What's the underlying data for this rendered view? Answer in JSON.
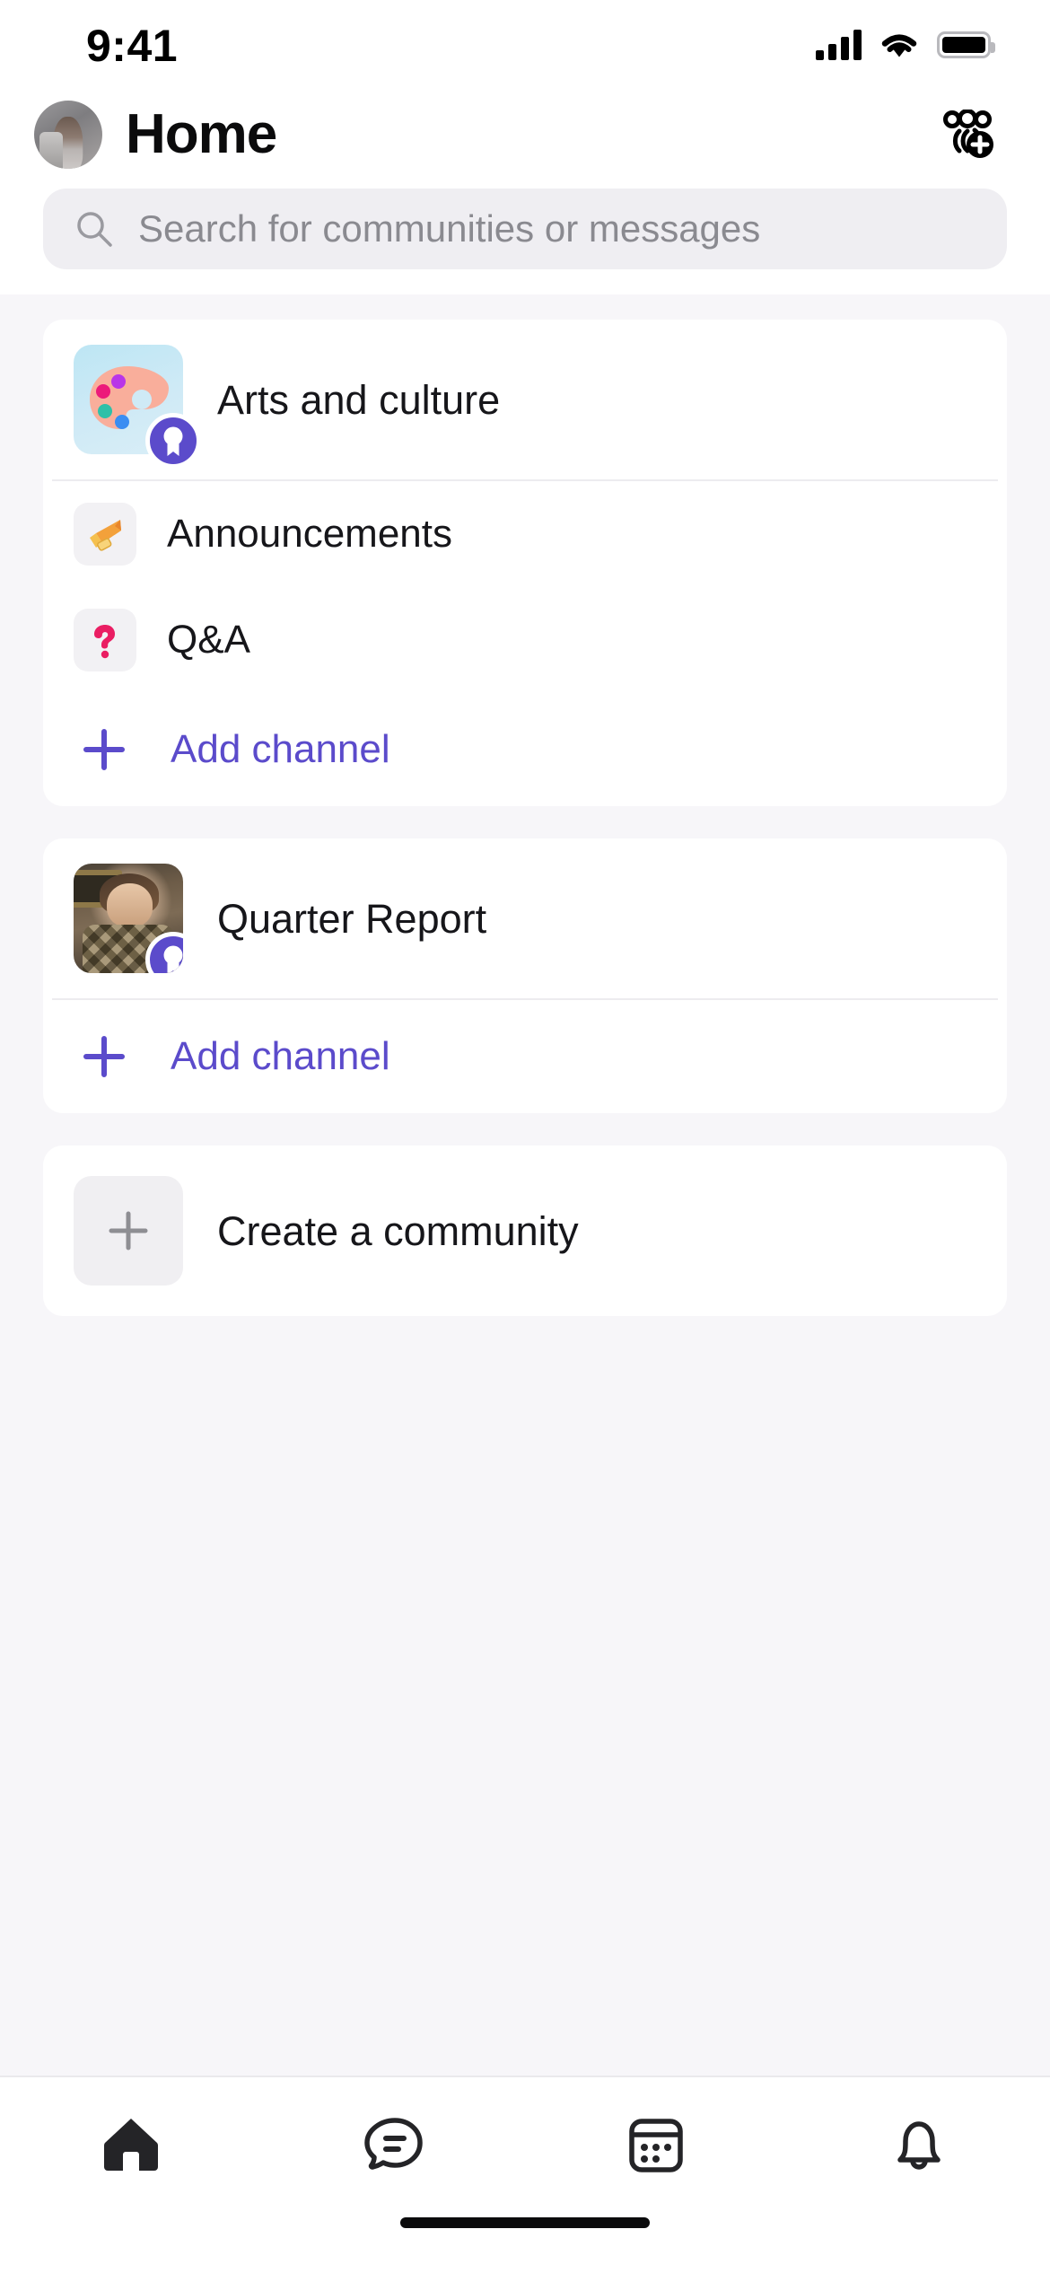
{
  "status_bar": {
    "time": "9:41",
    "icons": {
      "signal": "signal-bars-icon",
      "wifi": "wifi-icon",
      "battery": "battery-full-icon"
    }
  },
  "header": {
    "title": "Home",
    "avatar_name": "user-avatar",
    "action_icon": "add-people-icon"
  },
  "search": {
    "placeholder": "Search for communities or messages",
    "value": "",
    "icon": "search-icon"
  },
  "colors": {
    "accent_purple": "#5B4BCB",
    "page_background": "#F7F6F9",
    "card_background": "#FFFFFF",
    "search_background": "#EFEEF2",
    "text_primary": "#16161A",
    "text_muted": "#8A8A90"
  },
  "communities": [
    {
      "name": "Arts and culture",
      "avatar_icon": "palette-icon",
      "owner_badge": "owner-award-badge",
      "channels": [
        {
          "name": "Announcements",
          "icon": "megaphone-icon"
        },
        {
          "name": "Q&A",
          "icon": "question-mark-icon"
        }
      ],
      "add_channel_label": "Add channel",
      "add_channel_icon": "plus-icon"
    },
    {
      "name": "Quarter Report",
      "avatar_icon": "photo-avatar",
      "owner_badge": "owner-award-badge",
      "channels": [],
      "add_channel_label": "Add channel",
      "add_channel_icon": "plus-icon"
    }
  ],
  "create_community": {
    "label": "Create a community",
    "icon": "plus-icon"
  },
  "tab_bar": {
    "active_index": 0,
    "tabs": [
      {
        "name": "home",
        "icon": "home-icon"
      },
      {
        "name": "chats",
        "icon": "chat-bubble-icon"
      },
      {
        "name": "calendar",
        "icon": "calendar-icon"
      },
      {
        "name": "notifications",
        "icon": "bell-icon"
      }
    ]
  }
}
